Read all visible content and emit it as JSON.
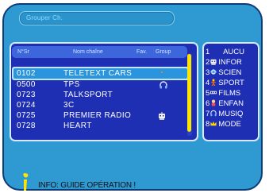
{
  "menu": {
    "title": "Grouper Ch."
  },
  "table": {
    "columns": {
      "number": "N°Sr",
      "name": "Nom chaîne",
      "fav": "Fav.",
      "group": "Group"
    },
    "rows": [
      {
        "num": "0102",
        "name": "TELETEXT CARS",
        "icon": "moon-star-icon",
        "selected": true
      },
      {
        "num": "0500",
        "name": "TPS",
        "icon": "headphones-icon",
        "selected": false
      },
      {
        "num": "0723",
        "name": "TALKSPORT",
        "icon": "",
        "selected": false
      },
      {
        "num": "0724",
        "name": "3C",
        "icon": "",
        "selected": false
      },
      {
        "num": "0725",
        "name": "PREMIER RADIO",
        "icon": "robot-icon",
        "selected": false
      },
      {
        "num": "0728",
        "name": "HEART",
        "icon": "",
        "selected": false
      }
    ]
  },
  "genres": [
    {
      "num": "1",
      "label": "AUCU",
      "icon": ""
    },
    {
      "num": "2",
      "label": "INFOR",
      "icon": "robot-icon"
    },
    {
      "num": "3",
      "label": "SCIEN",
      "icon": "science-icon"
    },
    {
      "num": "4",
      "label": "SPORT",
      "icon": "sport-icon"
    },
    {
      "num": "5",
      "label": "FILMS",
      "icon": "film-icon"
    },
    {
      "num": "6",
      "label": "ENFAN",
      "icon": "child-icon"
    },
    {
      "num": "7",
      "label": "MUSIQ",
      "icon": "headphones-icon"
    },
    {
      "num": "8",
      "label": "MODE",
      "icon": "crown-icon"
    }
  ],
  "info": {
    "text": "INFO: GUIDE OPÉRATION !"
  },
  "colors": {
    "panel": "#1f2fb3",
    "frame": "#2f9ad2",
    "highlight": "#2a95dc",
    "scroll": "#ffe400"
  }
}
